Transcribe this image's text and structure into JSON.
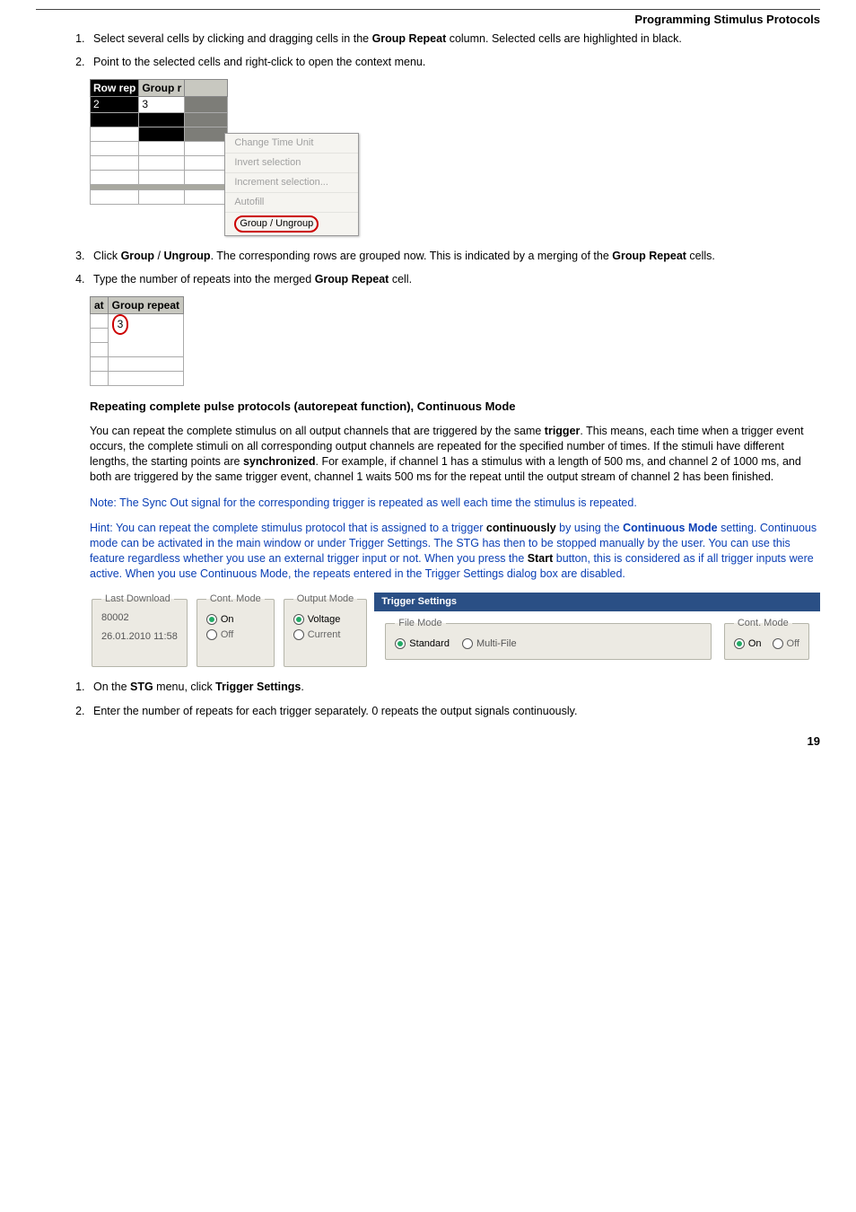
{
  "header": {
    "title": "Programming Stimulus Protocols"
  },
  "steps_a": {
    "s1a": "Select several cells by clicking and dragging cells in the ",
    "s1b": "Group Repeat",
    "s1c": " column. Selected cells are highlighted in black.",
    "s2": "Point to the selected cells and right-click to open the context menu."
  },
  "shot1": {
    "h1": "Row rep",
    "h2": "Group r",
    "v1": "2",
    "v2": "3",
    "menu": {
      "m1": "Change Time Unit",
      "m2": "Invert selection",
      "m3": "Increment selection...",
      "m4": "Autofill",
      "m5": "Group / Ungroup"
    }
  },
  "steps_b": {
    "s3a": "Click ",
    "s3b": "Group",
    "s3c": " / ",
    "s3d": "Ungroup",
    "s3e": ". The corresponding rows are grouped now. This is indicated by a merging of the ",
    "s3f": "Group Repeat",
    "s3g": " cells.",
    "s4a": "Type the number of repeats into the merged ",
    "s4b": "Group Repeat",
    "s4c": " cell."
  },
  "shot2": {
    "h1": "at",
    "h2": "Group repeat",
    "val": "3"
  },
  "section": "Repeating complete pulse protocols (autorepeat function), Continuous Mode",
  "para1": {
    "t1": "You can repeat the complete stimulus on all output channels that are triggered by the same ",
    "t2": "trigger",
    "t3": ". This means, each time when a trigger event occurs, the complete stimuli on all corresponding output channels are repeated for the specified number of times. If the stimuli have different lengths, the starting points are ",
    "t4": "synchronized",
    "t5": ". For example, if channel 1 has a stimulus with a length of 500 ms, and channel 2 of 1000 ms, and both are triggered by the same trigger event, channel 1 waits 500 ms for the repeat until the output stream of channel 2 has been finished."
  },
  "note": "Note: The Sync Out signal for the corresponding trigger is repeated as well each time the stimulus is repeated.",
  "hint": {
    "h1": "Hint: You can repeat the complete stimulus protocol that is assigned to a trigger ",
    "h2": "continuously",
    "h3": " by using the ",
    "h4": "Continuous Mode",
    "h5": " setting. Continuous mode can be activated in the main window or under Trigger Settings.  The STG has then to be stopped manually by the user. You can use this feature regardless whether you use an external trigger input or not. When you press the ",
    "h6": "Start",
    "h7": " button, this is considered as if all trigger inputs were active. When you use Continuous Mode, the repeats entered in the Trigger Settings dialog box are disabled."
  },
  "panel": {
    "last_dl_legend": "Last Download",
    "last_dl_v1": "80002",
    "last_dl_v2": "26.01.2010 11:58",
    "contmode_legend": "Cont. Mode",
    "on": "On",
    "off": "Off",
    "outmode_legend": "Output Mode",
    "voltage": "Voltage",
    "current": "Current",
    "trig_title": "Trigger Settings",
    "filemode_legend": "File Mode",
    "standard": "Standard",
    "multifile": "Multi-File"
  },
  "steps_c": {
    "s1a": "On the ",
    "s1b": "STG",
    "s1c": " menu, click ",
    "s1d": "Trigger Settings",
    "s1e": ".",
    "s2": "Enter the number of repeats for each trigger separately. 0 repeats the output signals continuously."
  },
  "page": "19"
}
